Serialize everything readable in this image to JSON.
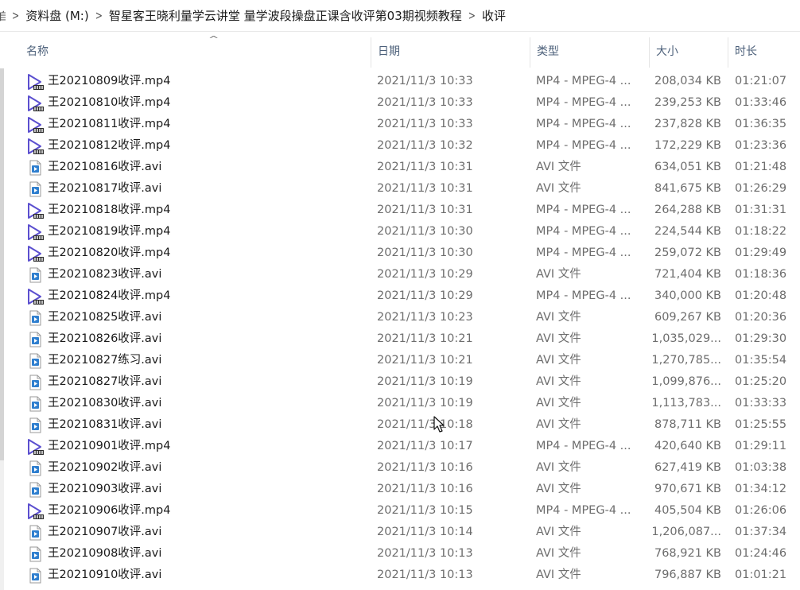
{
  "breadcrumb": {
    "edge_fragment": "自",
    "items": [
      "资料盘 (M:)",
      "智星客王晓利量学云讲堂 量学波段操盘正课含收评第03期视频教程",
      "收评"
    ]
  },
  "columns": {
    "name": "名称",
    "date": "日期",
    "type": "类型",
    "size": "大小",
    "duration": "时长"
  },
  "icons": {
    "mp4": "video-play-icon",
    "avi": "avi-file-icon"
  },
  "colors": {
    "header_text": "#4c607a",
    "meta_text": "#6d6d6d",
    "video_icon": "#5b4fcf",
    "avi_icon": "#2f7fcf"
  },
  "files": [
    {
      "name": "王20210809收评.mp4",
      "date": "2021/11/3 10:33",
      "type": "MP4 - MPEG-4 ...",
      "size": "208,034 KB",
      "duration": "01:21:07",
      "kind": "mp4"
    },
    {
      "name": "王20210810收评.mp4",
      "date": "2021/11/3 10:33",
      "type": "MP4 - MPEG-4 ...",
      "size": "239,253 KB",
      "duration": "01:33:46",
      "kind": "mp4"
    },
    {
      "name": "王20210811收评.mp4",
      "date": "2021/11/3 10:33",
      "type": "MP4 - MPEG-4 ...",
      "size": "237,828 KB",
      "duration": "01:36:35",
      "kind": "mp4"
    },
    {
      "name": "王20210812收评.mp4",
      "date": "2021/11/3 10:32",
      "type": "MP4 - MPEG-4 ...",
      "size": "172,229 KB",
      "duration": "01:23:36",
      "kind": "mp4"
    },
    {
      "name": "王20210816收评.avi",
      "date": "2021/11/3 10:31",
      "type": "AVI 文件",
      "size": "634,051 KB",
      "duration": "01:21:48",
      "kind": "avi"
    },
    {
      "name": "王20210817收评.avi",
      "date": "2021/11/3 10:31",
      "type": "AVI 文件",
      "size": "841,675 KB",
      "duration": "01:26:29",
      "kind": "avi"
    },
    {
      "name": "王20210818收评.mp4",
      "date": "2021/11/3 10:31",
      "type": "MP4 - MPEG-4 ...",
      "size": "264,288 KB",
      "duration": "01:31:31",
      "kind": "mp4"
    },
    {
      "name": "王20210819收评.mp4",
      "date": "2021/11/3 10:30",
      "type": "MP4 - MPEG-4 ...",
      "size": "224,544 KB",
      "duration": "01:18:22",
      "kind": "mp4"
    },
    {
      "name": "王20210820收评.mp4",
      "date": "2021/11/3 10:30",
      "type": "MP4 - MPEG-4 ...",
      "size": "259,072 KB",
      "duration": "01:29:49",
      "kind": "mp4"
    },
    {
      "name": "王20210823收评.avi",
      "date": "2021/11/3 10:29",
      "type": "AVI 文件",
      "size": "721,404 KB",
      "duration": "01:18:36",
      "kind": "avi"
    },
    {
      "name": "王20210824收评.mp4",
      "date": "2021/11/3 10:29",
      "type": "MP4 - MPEG-4 ...",
      "size": "340,000 KB",
      "duration": "01:20:48",
      "kind": "mp4"
    },
    {
      "name": "王20210825收评.avi",
      "date": "2021/11/3 10:23",
      "type": "AVI 文件",
      "size": "609,267 KB",
      "duration": "01:20:36",
      "kind": "avi"
    },
    {
      "name": "王20210826收评.avi",
      "date": "2021/11/3 10:21",
      "type": "AVI 文件",
      "size": "1,035,029...",
      "duration": "01:29:30",
      "kind": "avi"
    },
    {
      "name": "王20210827练习.avi",
      "date": "2021/11/3 10:21",
      "type": "AVI 文件",
      "size": "1,270,785...",
      "duration": "01:35:54",
      "kind": "avi"
    },
    {
      "name": "王20210827收评.avi",
      "date": "2021/11/3 10:19",
      "type": "AVI 文件",
      "size": "1,099,876...",
      "duration": "01:25:20",
      "kind": "avi"
    },
    {
      "name": "王20210830收评.avi",
      "date": "2021/11/3 10:19",
      "type": "AVI 文件",
      "size": "1,113,783...",
      "duration": "01:33:33",
      "kind": "avi"
    },
    {
      "name": "王20210831收评.avi",
      "date": "2021/11/3 10:18",
      "type": "AVI 文件",
      "size": "878,711 KB",
      "duration": "01:25:55",
      "kind": "avi"
    },
    {
      "name": "王20210901收评.mp4",
      "date": "2021/11/3 10:17",
      "type": "MP4 - MPEG-4 ...",
      "size": "420,640 KB",
      "duration": "01:29:11",
      "kind": "mp4"
    },
    {
      "name": "王20210902收评.avi",
      "date": "2021/11/3 10:16",
      "type": "AVI 文件",
      "size": "627,419 KB",
      "duration": "01:03:38",
      "kind": "avi"
    },
    {
      "name": "王20210903收评.avi",
      "date": "2021/11/3 10:16",
      "type": "AVI 文件",
      "size": "970,671 KB",
      "duration": "01:34:12",
      "kind": "avi"
    },
    {
      "name": "王20210906收评.mp4",
      "date": "2021/11/3 10:15",
      "type": "MP4 - MPEG-4 ...",
      "size": "405,504 KB",
      "duration": "01:26:06",
      "kind": "mp4"
    },
    {
      "name": "王20210907收评.avi",
      "date": "2021/11/3 10:14",
      "type": "AVI 文件",
      "size": "1,206,087...",
      "duration": "01:37:34",
      "kind": "avi"
    },
    {
      "name": "王20210908收评.avi",
      "date": "2021/11/3 10:13",
      "type": "AVI 文件",
      "size": "768,921 KB",
      "duration": "01:24:46",
      "kind": "avi"
    },
    {
      "name": "王20210910收评.avi",
      "date": "2021/11/3 10:13",
      "type": "AVI 文件",
      "size": "796,887 KB",
      "duration": "01:01:21",
      "kind": "avi"
    }
  ]
}
